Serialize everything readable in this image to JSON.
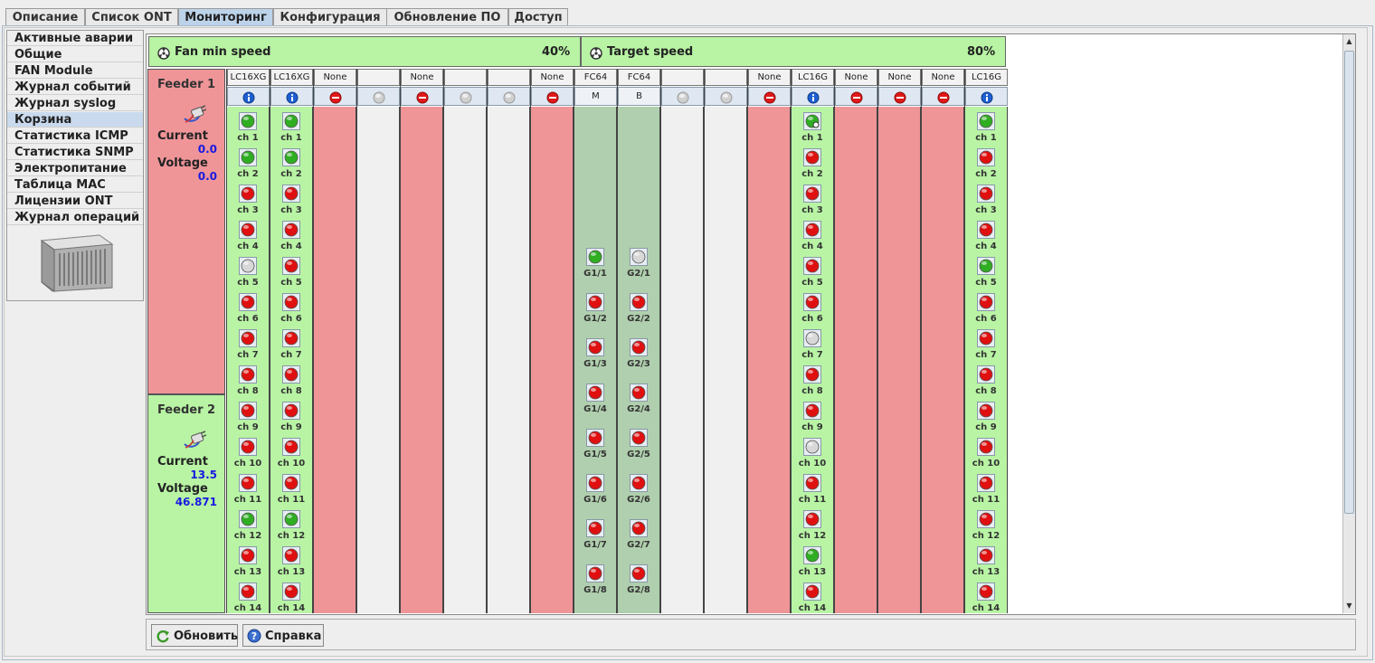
{
  "tabs": [
    "Описание",
    "Список ONT",
    "Мониторинг",
    "Конфигурация",
    "Обновление ПО",
    "Доступ"
  ],
  "active_tab": 2,
  "sidebar": {
    "items": [
      "Активные аварии",
      "Общие",
      "FAN Module",
      "Журнал событий",
      "Журнал syslog",
      "Корзина",
      "Статистика ICMP",
      "Статистика SNMP",
      "Электропитание",
      "Таблица MAC",
      "Лицензии ONT",
      "Журнал операций"
    ],
    "selected": 5
  },
  "fans": {
    "min_label": "Fan min speed",
    "min_value": "40%",
    "target_label": "Target speed",
    "target_value": "80%"
  },
  "feeders": [
    {
      "title": "Feeder 1",
      "current_label": "Current",
      "current": "0.0",
      "voltage_label": "Voltage",
      "voltage": "0.0",
      "status": "alarm"
    },
    {
      "title": "Feeder 2",
      "current_label": "Current",
      "current": "13.5",
      "voltage_label": "Voltage",
      "voltage": "46.871",
      "status": "ok"
    }
  ],
  "slots": [
    {
      "type": "LC16XG",
      "icon": "info",
      "state": "card",
      "ports": [
        "ok",
        "ok",
        "alarm",
        "alarm",
        "off",
        "alarm",
        "alarm",
        "alarm",
        "alarm",
        "alarm",
        "alarm",
        "ok",
        "alarm",
        "alarm"
      ]
    },
    {
      "type": "LC16XG",
      "icon": "info",
      "state": "card",
      "ports": [
        "ok",
        "ok",
        "alarm",
        "alarm",
        "alarm",
        "alarm",
        "alarm",
        "alarm",
        "alarm",
        "alarm",
        "alarm",
        "ok",
        "alarm",
        "alarm"
      ]
    },
    {
      "type": "None",
      "icon": "stop",
      "state": "none"
    },
    {
      "type": "",
      "icon": "gray",
      "state": "empty"
    },
    {
      "type": "None",
      "icon": "stop",
      "state": "none"
    },
    {
      "type": "",
      "icon": "gray",
      "state": "empty"
    },
    {
      "type": "",
      "icon": "gray",
      "state": "empty"
    },
    {
      "type": "None",
      "icon": "stop",
      "state": "none"
    },
    {
      "type": "FC64",
      "icon": "text",
      "icon_text": "M",
      "state": "fabric",
      "group": "G1",
      "ports": [
        "ok",
        "alarm",
        "alarm",
        "alarm",
        "alarm",
        "alarm",
        "alarm",
        "alarm"
      ]
    },
    {
      "type": "FC64",
      "icon": "text",
      "icon_text": "B",
      "state": "fabric",
      "group": "G2",
      "ports": [
        "off",
        "alarm",
        "alarm",
        "alarm",
        "alarm",
        "alarm",
        "alarm",
        "alarm"
      ]
    },
    {
      "type": "",
      "icon": "gray",
      "state": "empty"
    },
    {
      "type": "",
      "icon": "gray",
      "state": "empty"
    },
    {
      "type": "None",
      "icon": "stop",
      "state": "none"
    },
    {
      "type": "LC16G",
      "icon": "info",
      "state": "card",
      "ports": [
        "ok-link",
        "alarm",
        "alarm",
        "alarm",
        "alarm",
        "alarm",
        "off",
        "alarm",
        "alarm",
        "off",
        "alarm",
        "alarm",
        "ok",
        "alarm"
      ]
    },
    {
      "type": "None",
      "icon": "stop",
      "state": "none"
    },
    {
      "type": "None",
      "icon": "stop",
      "state": "none"
    },
    {
      "type": "None",
      "icon": "stop",
      "state": "none"
    },
    {
      "type": "LC16G",
      "icon": "info",
      "state": "card",
      "ports": [
        "ok",
        "alarm",
        "alarm",
        "alarm",
        "ok",
        "alarm",
        "alarm",
        "alarm",
        "alarm",
        "alarm",
        "alarm",
        "alarm",
        "alarm",
        "alarm"
      ]
    }
  ],
  "channel_prefix": "ch",
  "buttons": {
    "refresh": "Обновить",
    "help": "Справка"
  },
  "colors": {
    "ok_bg": "#b8f4a4",
    "alarm_bg": "#ef9598",
    "fabric_bg": "#b0cfae",
    "empty_bg": "#f0f0f0",
    "led_ok": "#2fae22",
    "led_alarm": "#e01010",
    "led_off": "#d8d8d8"
  }
}
